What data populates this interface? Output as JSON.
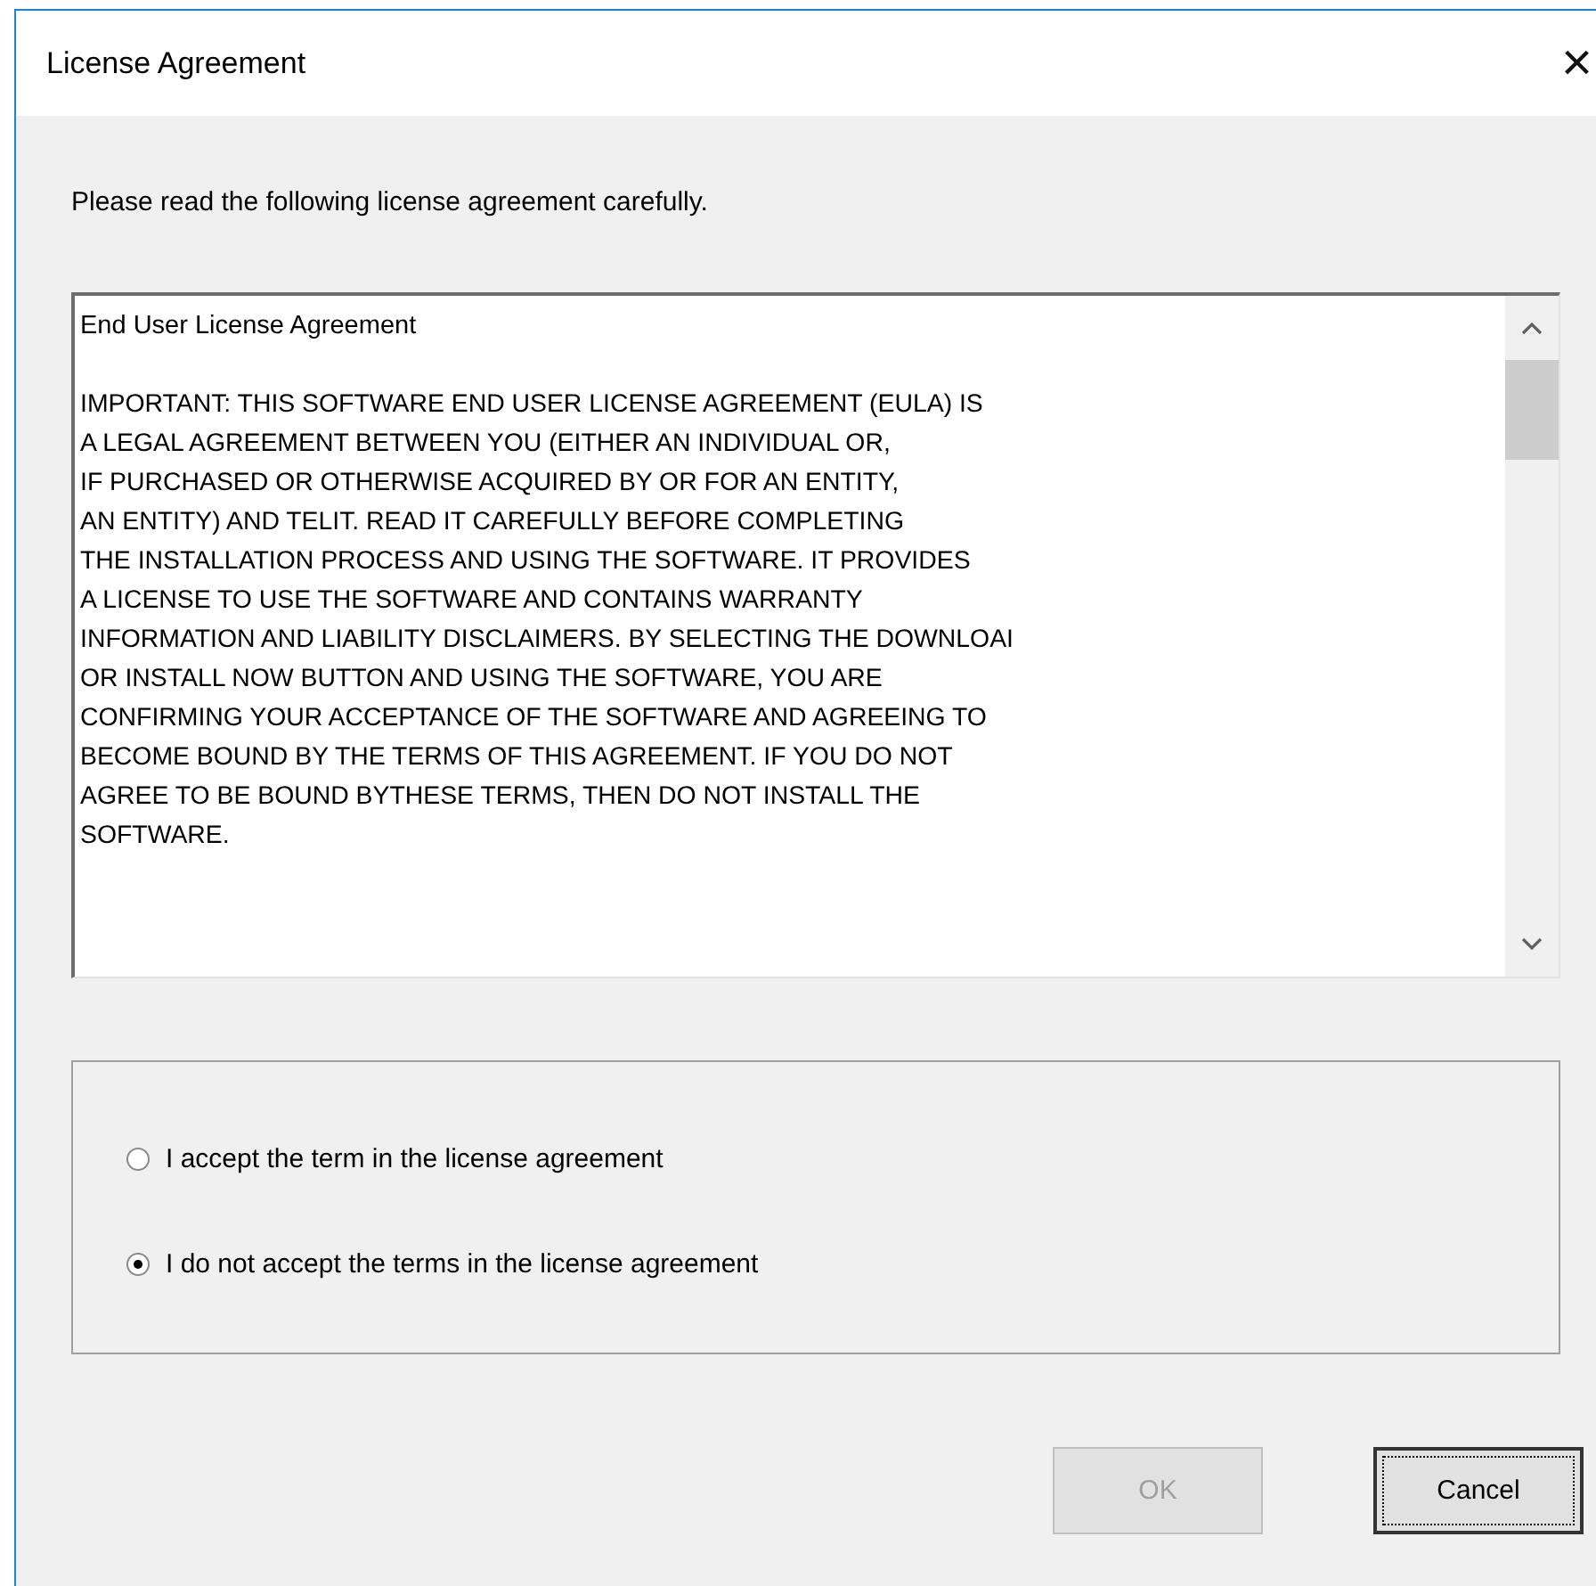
{
  "window": {
    "title": "License Agreement",
    "close": "×"
  },
  "instruction": "Please read the following license agreement carefully.",
  "license": {
    "heading": "End User License Agreement",
    "lines": [
      "IMPORTANT: THIS SOFTWARE END USER LICENSE AGREEMENT (EULA) IS",
      "A LEGAL AGREEMENT BETWEEN YOU (EITHER AN INDIVIDUAL OR,",
      "IF PURCHASED OR OTHERWISE ACQUIRED BY OR FOR AN ENTITY,",
      "AN ENTITY) AND TELIT. READ IT CAREFULLY BEFORE COMPLETING",
      "THE INSTALLATION PROCESS AND USING THE SOFTWARE. IT PROVIDES",
      "A LICENSE TO USE THE SOFTWARE AND CONTAINS WARRANTY",
      "INFORMATION AND LIABILITY DISCLAIMERS. BY SELECTING THE DOWNLOAI",
      "OR INSTALL NOW BUTTON AND USING THE SOFTWARE, YOU ARE",
      "CONFIRMING YOUR ACCEPTANCE OF THE SOFTWARE AND AGREEING TO",
      "BECOME BOUND BY THE TERMS OF THIS AGREEMENT. IF YOU DO NOT",
      "AGREE TO BE BOUND BYTHESE TERMS, THEN DO NOT INSTALL THE",
      "SOFTWARE."
    ]
  },
  "options": [
    {
      "label": "I accept the term in the license agreement",
      "selected": false
    },
    {
      "label": "I do not accept the terms in the license agreement",
      "selected": true
    }
  ],
  "buttons": [
    {
      "label": "OK",
      "disabled": true,
      "focused": false
    },
    {
      "label": "Cancel",
      "disabled": false,
      "focused": true
    }
  ]
}
